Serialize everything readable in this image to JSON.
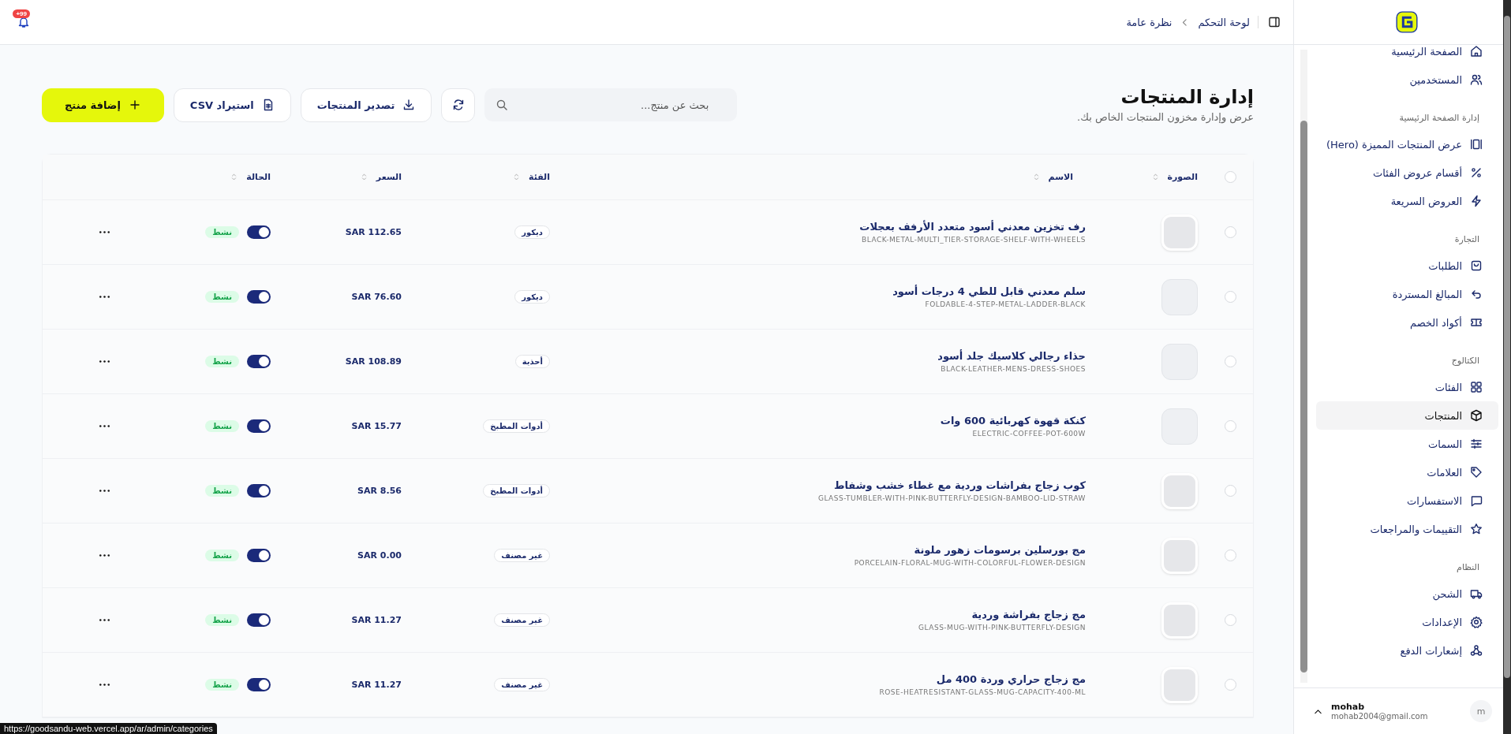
{
  "header": {
    "breadcrumb": [
      "لوحة التحكم",
      "نظرة عامة"
    ],
    "notification_badge": "+99"
  },
  "sidebar": {
    "sections": [
      {
        "items": [
          {
            "label": "الصفحة الرئيسية",
            "selected": false
          },
          {
            "label": "المستخدمين",
            "selected": false
          }
        ]
      },
      {
        "title": "إدارة الصفحة الرئيسية",
        "items": [
          {
            "label": "عرض المنتجات المميزة (Hero)",
            "selected": false
          },
          {
            "label": "أقسام عروض الفئات",
            "selected": false
          },
          {
            "label": "العروض السريعة",
            "selected": false
          }
        ]
      },
      {
        "title": "التجارة",
        "items": [
          {
            "label": "الطلبات",
            "selected": false
          },
          {
            "label": "المبالغ المستردة",
            "selected": false
          },
          {
            "label": "أكواد الخصم",
            "selected": false
          }
        ]
      },
      {
        "title": "الكتالوج",
        "items": [
          {
            "label": "الفئات",
            "selected": false
          },
          {
            "label": "المنتجات",
            "selected": true
          },
          {
            "label": "السمات",
            "selected": false
          },
          {
            "label": "العلامات",
            "selected": false
          },
          {
            "label": "الاستفسارات",
            "selected": false
          },
          {
            "label": "التقييمات والمراجعات",
            "selected": false
          }
        ]
      },
      {
        "title": "النظام",
        "items": [
          {
            "label": "الشحن",
            "selected": false
          },
          {
            "label": "الإعدادات",
            "selected": false
          },
          {
            "label": "إشعارات الدفع",
            "selected": false
          }
        ]
      }
    ],
    "user": {
      "avatar": "m",
      "name": "mohab",
      "email": "mohab2004@gmail.com"
    }
  },
  "page": {
    "title": "إدارة المنتجات",
    "subtitle": "عرض وإدارة مخزون المنتجات الخاص بك.",
    "search_placeholder": "بحث عن منتج...",
    "buttons": [
      {
        "kind": "refresh"
      },
      {
        "kind": "export",
        "label": "تصدير المنتجات"
      },
      {
        "kind": "import",
        "label": "استيراد CSV"
      },
      {
        "kind": "add",
        "label": "إضافة منتج"
      }
    ]
  },
  "table": {
    "all_selected": false,
    "columns": [
      "الصورة",
      "الاسم",
      "الفئة",
      "السعر",
      "الحالة"
    ]
  },
  "products": [
    {
      "selected": false,
      "has_photo": true,
      "name": "رف تخزين معدني أسود متعدد الأرفف بعجلات",
      "slug": "BLACK-METAL-MULTI_TIER-STORAGE-SHELF-WITH-WHEELS",
      "category": "ديكور",
      "price": "SAR 112.65",
      "active": true,
      "status": "نشط"
    },
    {
      "selected": false,
      "has_photo": false,
      "name": "سلم معدني قابل للطي 4 درجات أسود",
      "slug": "FOLDABLE-4-STEP-METAL-LADDER-BLACK",
      "category": "ديكور",
      "price": "SAR 76.60",
      "active": true,
      "status": "نشط"
    },
    {
      "selected": false,
      "has_photo": false,
      "name": "حذاء رجالي كلاسيك جلد أسود",
      "slug": "BLACK-LEATHER-MENS-DRESS-SHOES",
      "category": "أحذية",
      "price": "SAR 108.89",
      "active": true,
      "status": "نشط"
    },
    {
      "selected": false,
      "has_photo": false,
      "name": "كنكة قهوة كهربائية 600 وات",
      "slug": "ELECTRIC-COFFEE-POT-600W",
      "category": "أدوات المطبخ",
      "price": "SAR 15.77",
      "active": true,
      "status": "نشط"
    },
    {
      "selected": false,
      "has_photo": true,
      "name": "كوب زجاج بفراشات وردية مع غطاء خشب وشفاط",
      "slug": "GLASS-TUMBLER-WITH-PINK-BUTTERFLY-DESIGN-BAMBOO-LID-STRAW",
      "category": "أدوات المطبخ",
      "price": "SAR 8.56",
      "active": true,
      "status": "نشط"
    },
    {
      "selected": false,
      "has_photo": true,
      "name": "مج بورسلين برسومات زهور ملونة",
      "slug": "PORCELAIN-FLORAL-MUG-WITH-COLORFUL-FLOWER-DESIGN",
      "category": "غير مصنف",
      "price": "SAR 0.00",
      "active": true,
      "status": "نشط"
    },
    {
      "selected": false,
      "has_photo": true,
      "name": "مج زجاج بفراشة وردية",
      "slug": "GLASS-MUG-WITH-PINK-BUTTERFLY-DESIGN",
      "category": "غير مصنف",
      "price": "SAR 11.27",
      "active": true,
      "status": "نشط"
    },
    {
      "selected": false,
      "has_photo": true,
      "name": "مج زجاج حراري وردة 400 مل",
      "slug": "ROSE-HEATRESISTANT-GLASS-MUG-CAPACITY-400-ML",
      "category": "غير مصنف",
      "price": "SAR 11.27",
      "active": true,
      "status": "نشط"
    }
  ],
  "status_bar": {
    "url": "https://goodsandu-web.vercel.app/ar/admin/categories"
  }
}
